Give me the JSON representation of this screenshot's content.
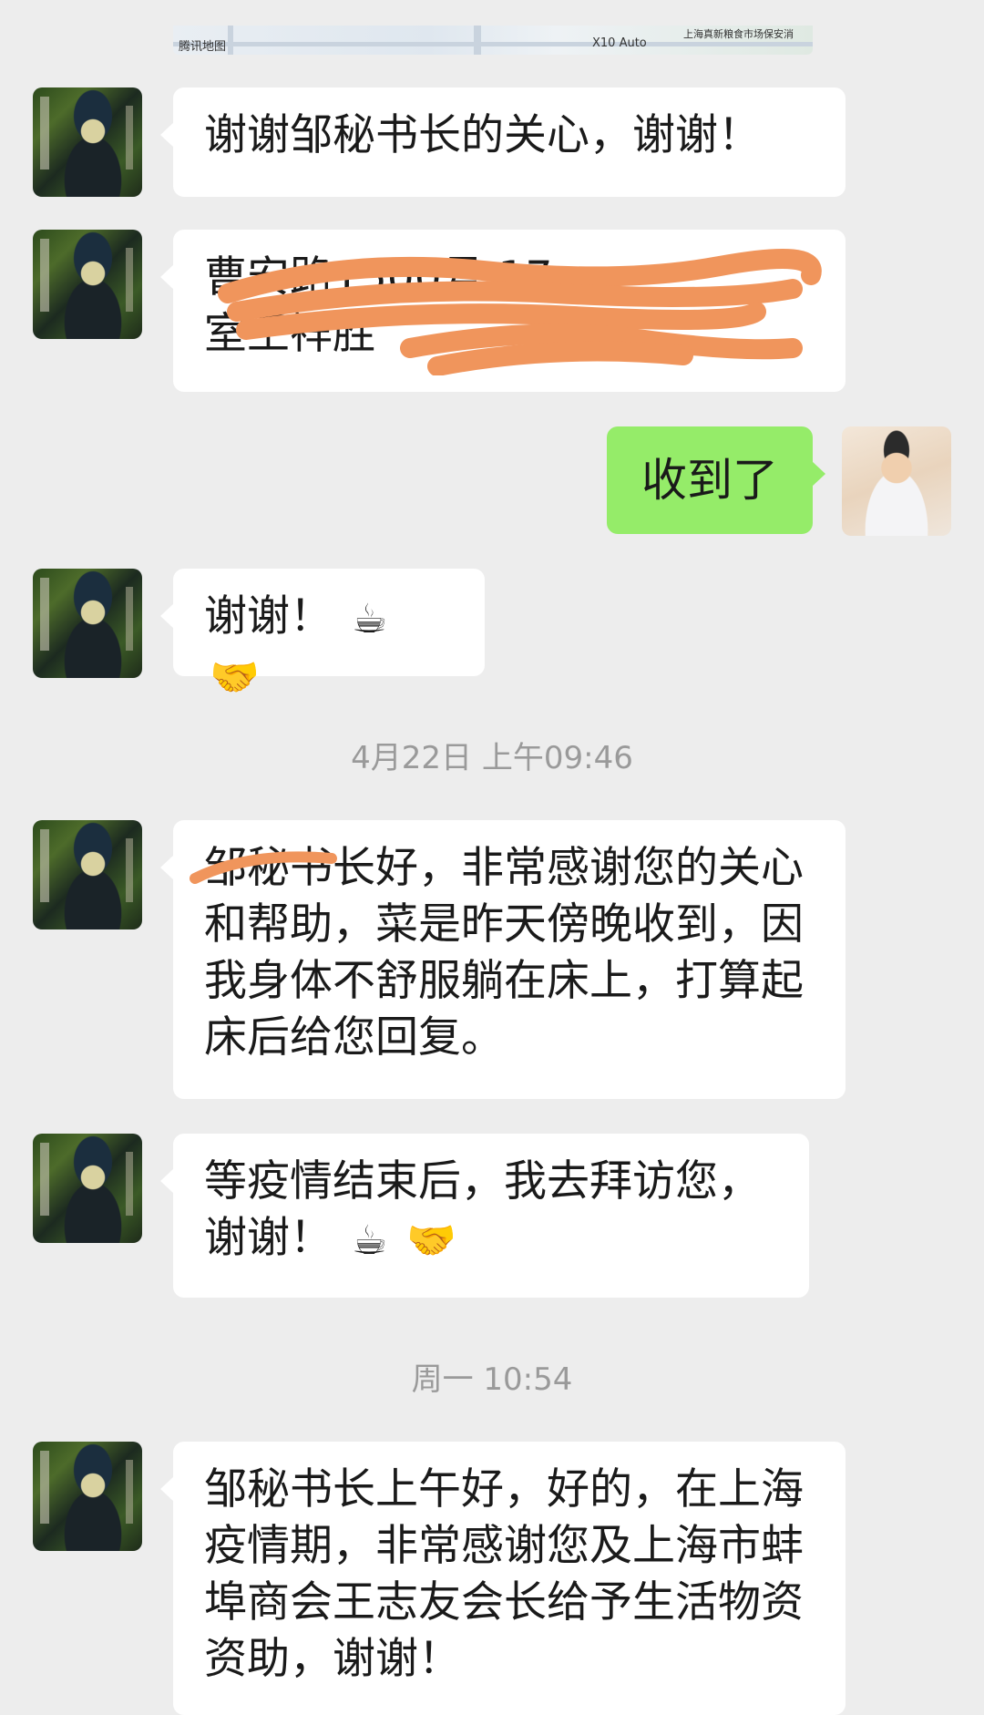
{
  "map_preview": {
    "labels": [
      "腾讯地图",
      "X10 Auto",
      "上海真新粮食市场保安消"
    ]
  },
  "messages": [
    {
      "side": "left",
      "text": "谢谢邹秘书长的关心，谢谢！"
    },
    {
      "side": "left",
      "text_line1": "曹安路1500号 17",
      "text_line2": "室王祥胜"
    },
    {
      "side": "right",
      "text": "收到了"
    },
    {
      "side": "left",
      "text": "谢谢！",
      "emoji1": "☕",
      "emoji2": "🤝"
    },
    {
      "side": "left",
      "text": "邹秘书长好，非常感谢您的关心和帮助，菜是昨天傍晚收到，因我身体不舒服躺在床上，打算起床后给您回复。"
    },
    {
      "side": "left",
      "text_line1": "等疫情结束后，我去拜访您，",
      "text_line2": "谢谢！",
      "emoji1": "☕",
      "emoji2": "🤝"
    },
    {
      "side": "left",
      "text": "邹秘书长上午好，好的，在上海疫情期，非常感谢您及上海市蚌埠商会王志友会长给予生活物资资助，谢谢！"
    }
  ],
  "timestamps": [
    "4月22日 上午09:46",
    "周一 10:54"
  ],
  "colors": {
    "background": "#ededed",
    "bubble_left": "#ffffff",
    "bubble_right": "#95ec69",
    "redaction": "#f0955c",
    "timestamp": "#9a9a9a"
  }
}
